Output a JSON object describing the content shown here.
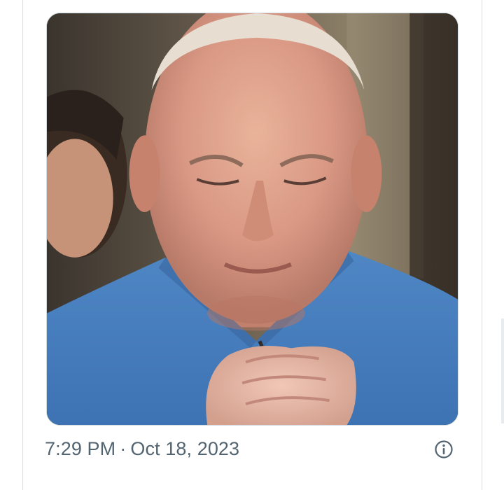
{
  "tweet": {
    "media": {
      "image_icon": "photo",
      "border_color": "#cfd9de"
    },
    "timestamp": {
      "time": "7:29 PM",
      "separator": "·",
      "date": "Oct 18, 2023",
      "color": "#536471"
    },
    "info_icon": "info-circle-icon"
  }
}
